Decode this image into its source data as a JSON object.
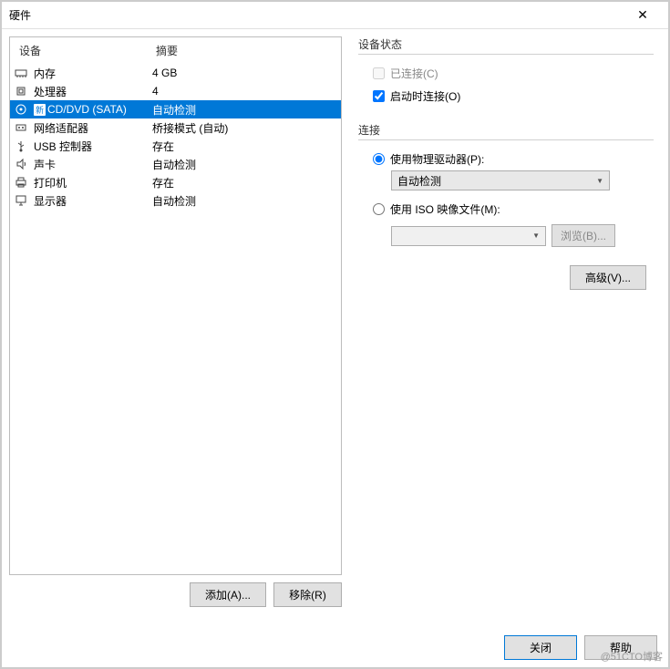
{
  "window": {
    "title": "硬件"
  },
  "headers": {
    "device": "设备",
    "summary": "摘要"
  },
  "devices": [
    {
      "icon": "memory",
      "name": "内存",
      "summary": "4 GB",
      "selected": false
    },
    {
      "icon": "cpu",
      "name": "处理器",
      "summary": "4",
      "selected": false
    },
    {
      "icon": "cd",
      "name": "CD/DVD (SATA)",
      "summary": "自动检测",
      "selected": true,
      "new": "新"
    },
    {
      "icon": "network",
      "name": "网络适配器",
      "summary": "桥接模式 (自动)",
      "selected": false
    },
    {
      "icon": "usb",
      "name": "USB 控制器",
      "summary": "存在",
      "selected": false
    },
    {
      "icon": "sound",
      "name": "声卡",
      "summary": "自动检测",
      "selected": false
    },
    {
      "icon": "printer",
      "name": "打印机",
      "summary": "存在",
      "selected": false
    },
    {
      "icon": "display",
      "name": "显示器",
      "summary": "自动检测",
      "selected": false
    }
  ],
  "buttons": {
    "add": "添加(A)...",
    "remove": "移除(R)",
    "advanced": "高级(V)...",
    "browse": "浏览(B)...",
    "close": "关闭",
    "help": "帮助"
  },
  "rightPanel": {
    "deviceStatusTitle": "设备状态",
    "connected": "已连接(C)",
    "connectAtPowerOn": "启动时连接(O)",
    "connectionTitle": "连接",
    "usePhysicalDrive": "使用物理驱动器(P):",
    "autoDetect": "自动检测",
    "useIsoFile": "使用 ISO 映像文件(M):"
  },
  "watermark": "@51CTO博客"
}
